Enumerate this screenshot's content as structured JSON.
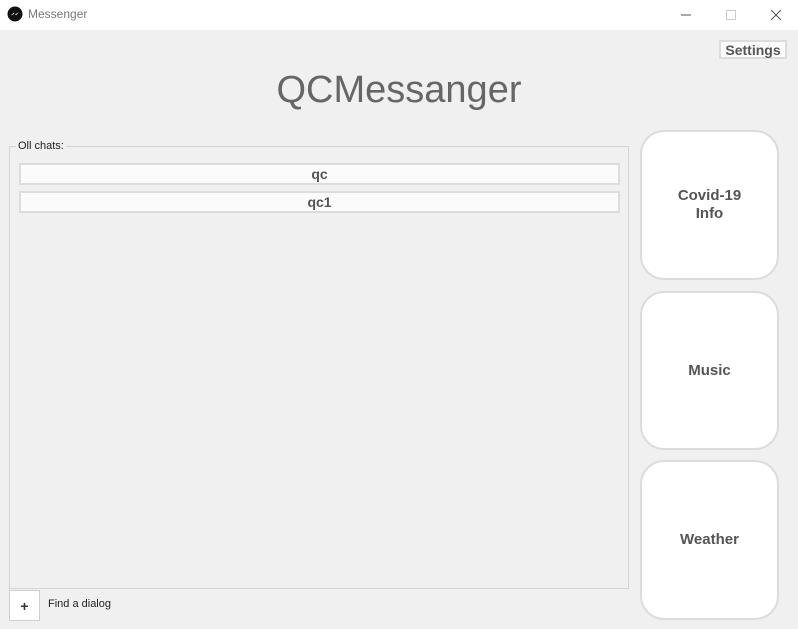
{
  "window": {
    "title": "Messenger",
    "icon": "messenger-icon",
    "controls": [
      "minimize-icon",
      "maximize-icon",
      "close-icon"
    ]
  },
  "header": {
    "settings_label": "Settings",
    "app_title": "QCMessanger"
  },
  "chats": {
    "group_label": "Oll chats:",
    "items": [
      {
        "label": "qc"
      },
      {
        "label": "qc1"
      }
    ]
  },
  "footer": {
    "add_label": "+",
    "find_label": "Find a dialog"
  },
  "tiles": [
    {
      "label": "Covid-19\nInfo"
    },
    {
      "label": "Music"
    },
    {
      "label": "Weather"
    }
  ]
}
